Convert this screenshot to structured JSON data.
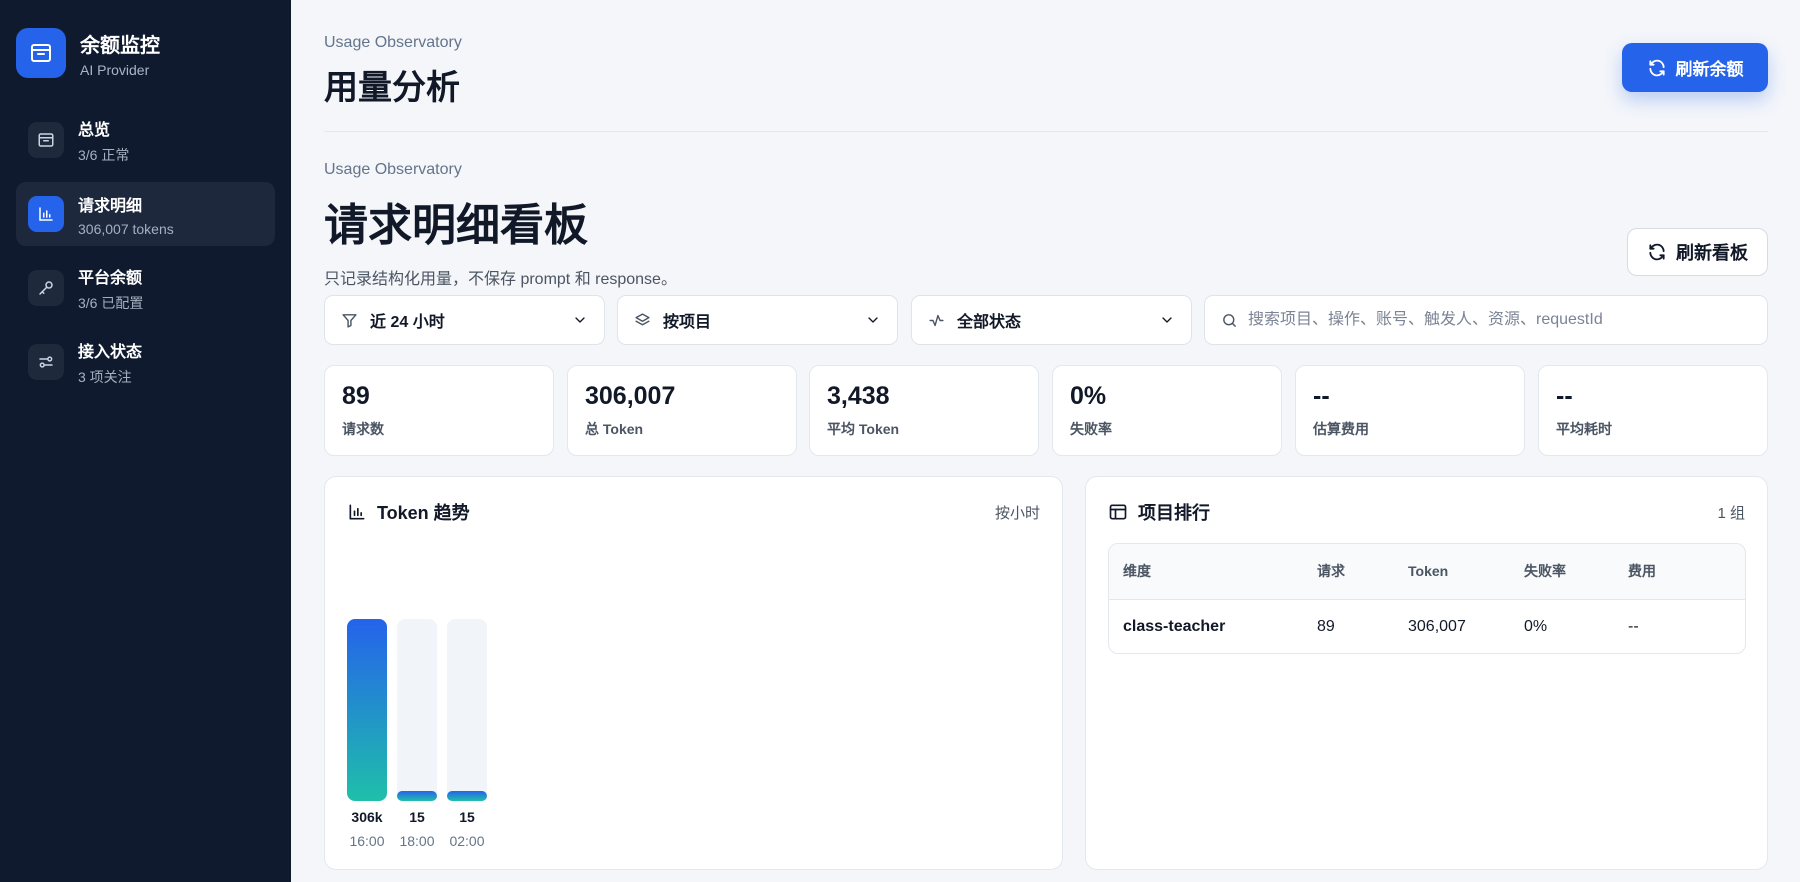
{
  "brand": {
    "title": "余额监控",
    "subtitle": "AI Provider",
    "icon": "inbox-icon"
  },
  "sidebar": {
    "items": [
      {
        "label": "总览",
        "sub": "3/6 正常",
        "icon": "inbox-icon",
        "active": false
      },
      {
        "label": "请求明细",
        "sub": "306,007 tokens",
        "icon": "bar-chart-icon",
        "active": true
      },
      {
        "label": "平台余额",
        "sub": "3/6 已配置",
        "icon": "key-icon",
        "active": false
      },
      {
        "label": "接入状态",
        "sub": "3 项关注",
        "icon": "sliders-icon",
        "active": false
      }
    ]
  },
  "header": {
    "eyebrow": "Usage Observatory",
    "title": "用量分析",
    "refresh_label": "刷新余额"
  },
  "section": {
    "eyebrow": "Usage Observatory",
    "title": "请求明细看板",
    "description": "只记录结构化用量，不保存 prompt 和 response。",
    "refresh_label": "刷新看板"
  },
  "filters": {
    "time_range": "近 24 小时",
    "group_by": "按项目",
    "status": "全部状态",
    "search_placeholder": "搜索项目、操作、账号、触发人、资源、requestId"
  },
  "stats": [
    {
      "value": "89",
      "label": "请求数"
    },
    {
      "value": "306,007",
      "label": "总 Token"
    },
    {
      "value": "3,438",
      "label": "平均 Token"
    },
    {
      "value": "0%",
      "label": "失败率"
    },
    {
      "value": "--",
      "label": "估算费用"
    },
    {
      "value": "--",
      "label": "平均耗时"
    }
  ],
  "trend": {
    "title": "Token 趋势",
    "meta": "按小时",
    "chart_data": {
      "type": "bar",
      "categories": [
        "16:00",
        "18:00",
        "02:00"
      ],
      "values": [
        306000,
        15,
        15
      ],
      "value_labels": [
        "306k",
        "15",
        "15"
      ]
    }
  },
  "ranking": {
    "title": "项目排行",
    "meta": "1 组",
    "columns": [
      "维度",
      "请求",
      "Token",
      "失败率",
      "费用"
    ],
    "rows": [
      [
        "class-teacher",
        "89",
        "306,007",
        "0%",
        "--"
      ]
    ]
  },
  "colors": {
    "accent": "#2563eb",
    "sidebar_bg": "#0f1a2e",
    "bar_gradient_end": "#1fbfaa"
  }
}
